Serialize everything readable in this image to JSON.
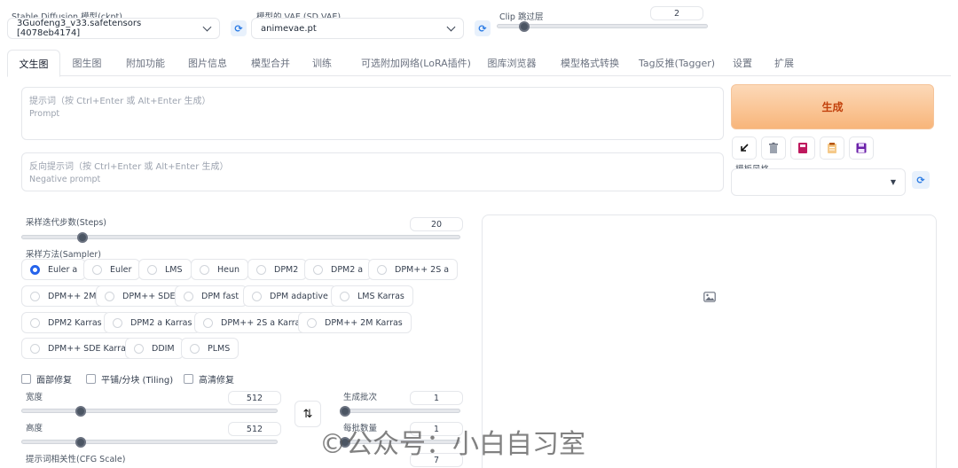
{
  "checkpoint": {
    "label": "Stable Diffusion 模型(ckpt)",
    "value": "3Guofeng3_v33.safetensors [4078eb4174]"
  },
  "vae": {
    "label": "模型的 VAE (SD VAE)",
    "value": "animevae.pt"
  },
  "clip_skip": {
    "label": "Clip 跳过层",
    "value": "2",
    "fraction": 0.11
  },
  "tabs": [
    {
      "label": "文生图"
    },
    {
      "label": "图生图"
    },
    {
      "label": "附加功能"
    },
    {
      "label": "图片信息"
    },
    {
      "label": "模型合并"
    },
    {
      "label": "训练"
    },
    {
      "label": "可选附加网络(LoRA插件)"
    },
    {
      "label": "图库浏览器"
    },
    {
      "label": "模型格式转换"
    },
    {
      "label": "Tag反推(Tagger)"
    },
    {
      "label": "设置"
    },
    {
      "label": "扩展"
    }
  ],
  "prompt": {
    "label": "提示词（按 Ctrl+Enter 或 Alt+Enter 生成）",
    "placeholder": "Prompt"
  },
  "negative_prompt": {
    "label": "反向提示词（按 Ctrl+Enter 或 Alt+Enter 生成）",
    "placeholder": "Negative prompt"
  },
  "generate": {
    "label": "生成"
  },
  "style": {
    "label": "模板风格"
  },
  "steps": {
    "label": "采样迭代步数(Steps)",
    "value": "20",
    "fraction": 0.13
  },
  "sampler": {
    "label": "采样方法(Sampler)",
    "selected": "Euler a",
    "options": [
      "Euler a",
      "Euler",
      "LMS",
      "Heun",
      "DPM2",
      "DPM2 a",
      "DPM++ 2S a",
      "DPM++ 2M",
      "DPM++ SDE",
      "DPM fast",
      "DPM adaptive",
      "LMS Karras",
      "DPM2 Karras",
      "DPM2 a Karras",
      "DPM++ 2S a Karras",
      "DPM++ 2M Karras",
      "DPM++ SDE Karras",
      "DDIM",
      "PLMS"
    ]
  },
  "options": {
    "face_restore": "面部修复",
    "tiling": "平铺/分块 (Tiling)",
    "hires_fix": "高清修复"
  },
  "width": {
    "label": "宽度",
    "value": "512",
    "fraction": 0.22
  },
  "height": {
    "label": "高度",
    "value": "512",
    "fraction": 0.22
  },
  "batch_count": {
    "label": "生成批次",
    "value": "1",
    "fraction": 0.0
  },
  "batch_size": {
    "label": "每批数量",
    "value": "1",
    "fraction": 0.0
  },
  "cfg_scale": {
    "label": "提示词相关性(CFG Scale)",
    "value": "7"
  },
  "watermark": "©公众号：小白自习室",
  "colors": {
    "accent": "#2563eb",
    "generate_bg": "#f8b57a",
    "generate_text": "#c2410c"
  }
}
